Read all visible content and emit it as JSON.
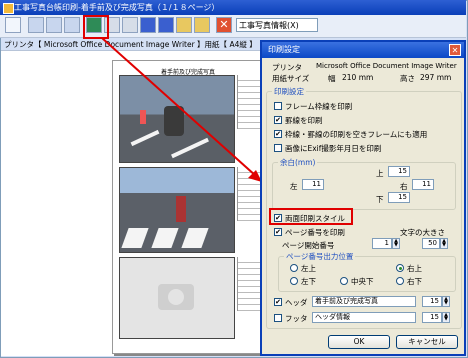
{
  "back_window": {
    "title": "工事写真台帳印刷-着手前及び完成写真（１/１８ページ）",
    "combo_value": "工事写真情報(X)",
    "printer_line": "プリンタ【 Microsoft Office Document Image Writer 】用紙【 A4縦 】",
    "page_title": "着手前及び完成写真"
  },
  "dialog": {
    "title": "印刷設定",
    "printer_label": "プリンタ",
    "printer_value": "Microsoft Office Document Image Writer",
    "paper_label": "用紙サイズ",
    "width_label": "幅",
    "width_value": "210 mm",
    "height_label": "高さ",
    "height_value": "297 mm",
    "section_print": "印刷設定",
    "opt_frame": "フレーム枠線を印刷",
    "opt_rule": "罫線を印刷",
    "opt_empty": "枠線・罫線の印刷を空きフレームにも適用",
    "opt_exif": "画像にExif撮影年月日を印刷",
    "margin_title": "余白(mm)",
    "margin_top_label": "上",
    "margin_top": "15",
    "margin_left_label": "左",
    "margin_left": "11",
    "margin_right_label": "右",
    "margin_right": "11",
    "margin_bottom_label": "下",
    "margin_bottom": "15",
    "opt_duplex": "両面印刷スタイル",
    "opt_pagenum": "ページ番号を印刷",
    "font_size_label": "文字の大きさ",
    "start_page_label": "ページ開始番号",
    "start_page": "1",
    "font_size": "50",
    "position_title": "ページ番号出力位置",
    "pos_tl": "左上",
    "pos_tr": "右上",
    "pos_bl": "左下",
    "pos_bc": "中央下",
    "pos_br": "右下",
    "header_label": "ヘッダ",
    "header_value": "着手前及び完成写真",
    "header_size": "15",
    "footer_label": "フッタ",
    "footer_value": "ヘッダ情報",
    "footer_size": "15",
    "ok": "OK",
    "cancel": "キャンセル"
  },
  "colors": {
    "highlight": "#e00000",
    "titlebar": "#0b48c6"
  }
}
